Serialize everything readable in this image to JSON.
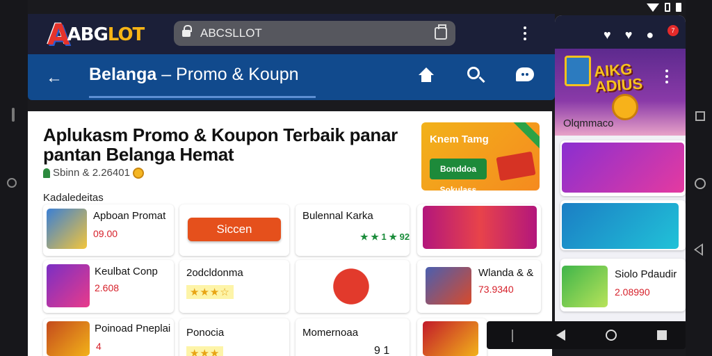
{
  "browser": {
    "logo_prefix": "A",
    "logo_text_main": "ABG",
    "logo_text_highlight": "LOT",
    "url": "ABCSLLOT"
  },
  "appbar": {
    "title_bold": "Belanga",
    "title_rest": " –  Promo & Koupn"
  },
  "hero": {
    "title": "Aplukasm Promo & Koupon Terbaik panar pantan Belanga Hemat",
    "meta": "Sbinn & 2.26401",
    "banner_title": "Knem Tamg",
    "banner_button": "Bonddoa Sokulass"
  },
  "section": {
    "label": "Kadaledeitas"
  },
  "cards": {
    "c1_title": "Apboan Promat",
    "c1_price": "09.00",
    "cta_label": "Siccen",
    "c3_title": "Bulennal Karka",
    "c3_rating": "★ ★ 1 ★ 92",
    "c5_title": "Keulbat Conp",
    "c5_price": "2.608",
    "c6_title": "2odcldonma",
    "c6_stars": "★★★☆",
    "c8_title": "Wlanda & &",
    "c8_price": "73.9340",
    "c9_title": "Poinoad Pneplai",
    "c9_price": "4",
    "c10_title": "Ponocia",
    "c10_stars": "★★★",
    "c11_title": "Momernoaa",
    "c11_num": "9 1"
  },
  "right_panel": {
    "promo_title_1": "AIKG",
    "promo_title_2": "ADIUS",
    "promo_label": "Olqmmaco",
    "badge": "7",
    "item3_title": "Siolo Pdaudir",
    "item3_price": "2.08990"
  },
  "colors": {
    "appbar_blue": "#114a8d",
    "price_red": "#d6202a",
    "cta_orange": "#e5501c",
    "banner_orange": "#f2b21a"
  }
}
